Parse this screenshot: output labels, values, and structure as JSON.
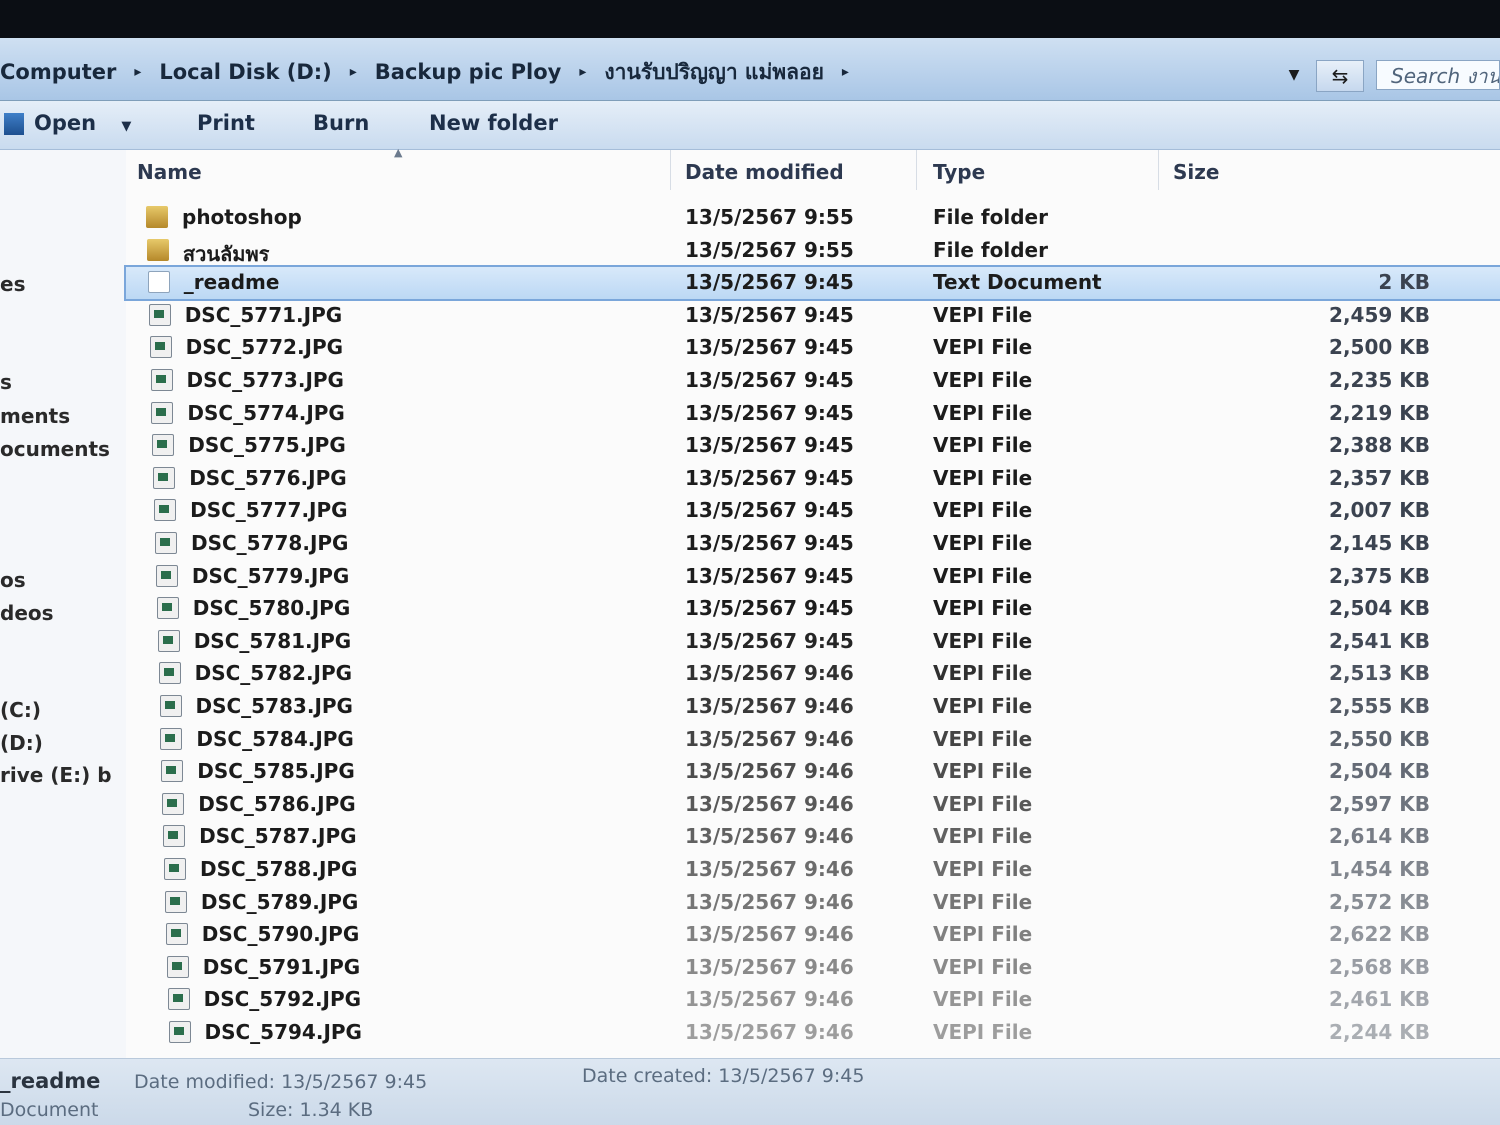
{
  "address": {
    "crumbs": [
      "Computer",
      "Local Disk (D:)",
      "Backup pic Ploy",
      "งานรับปริญญา แม่พลอย"
    ],
    "separator": "▸",
    "dropdown_icon": "chevron-down-icon",
    "refresh_icon": "refresh-icon",
    "search_placeholder": "Search งาน"
  },
  "toolbar": {
    "open_label": "Open",
    "print_label": "Print",
    "burn_label": "Burn",
    "new_folder_label": "New folder"
  },
  "nav": {
    "items": [
      "es",
      "s",
      "ments",
      "ocuments",
      "os",
      "deos",
      "(C:)",
      "(D:)",
      "rive (E:) b"
    ]
  },
  "columns": {
    "name": "Name",
    "date": "Date modified",
    "type": "Type",
    "size": "Size"
  },
  "files": [
    {
      "icon": "folder",
      "name": "photoshop",
      "date": "13/5/2567 9:55",
      "type": "File folder",
      "size": ""
    },
    {
      "icon": "folder",
      "name": "สวนลัมพร",
      "date": "13/5/2567 9:55",
      "type": "File folder",
      "size": ""
    },
    {
      "icon": "text",
      "name": "_readme",
      "date": "13/5/2567 9:45",
      "type": "Text Document",
      "size": "2 KB",
      "selected": true
    },
    {
      "icon": "image",
      "name": "DSC_5771.JPG",
      "date": "13/5/2567 9:45",
      "type": "VEPI File",
      "size": "2,459 KB"
    },
    {
      "icon": "image",
      "name": "DSC_5772.JPG",
      "date": "13/5/2567 9:45",
      "type": "VEPI File",
      "size": "2,500 KB"
    },
    {
      "icon": "image",
      "name": "DSC_5773.JPG",
      "date": "13/5/2567 9:45",
      "type": "VEPI File",
      "size": "2,235 KB"
    },
    {
      "icon": "image",
      "name": "DSC_5774.JPG",
      "date": "13/5/2567 9:45",
      "type": "VEPI File",
      "size": "2,219 KB"
    },
    {
      "icon": "image",
      "name": "DSC_5775.JPG",
      "date": "13/5/2567 9:45",
      "type": "VEPI File",
      "size": "2,388 KB"
    },
    {
      "icon": "image",
      "name": "DSC_5776.JPG",
      "date": "13/5/2567 9:45",
      "type": "VEPI File",
      "size": "2,357 KB"
    },
    {
      "icon": "image",
      "name": "DSC_5777.JPG",
      "date": "13/5/2567 9:45",
      "type": "VEPI File",
      "size": "2,007 KB"
    },
    {
      "icon": "image",
      "name": "DSC_5778.JPG",
      "date": "13/5/2567 9:45",
      "type": "VEPI File",
      "size": "2,145 KB"
    },
    {
      "icon": "image",
      "name": "DSC_5779.JPG",
      "date": "13/5/2567 9:45",
      "type": "VEPI File",
      "size": "2,375 KB"
    },
    {
      "icon": "image",
      "name": "DSC_5780.JPG",
      "date": "13/5/2567 9:45",
      "type": "VEPI File",
      "size": "2,504 KB"
    },
    {
      "icon": "image",
      "name": "DSC_5781.JPG",
      "date": "13/5/2567 9:45",
      "type": "VEPI File",
      "size": "2,541 KB"
    },
    {
      "icon": "image",
      "name": "DSC_5782.JPG",
      "date": "13/5/2567 9:46",
      "type": "VEPI File",
      "size": "2,513 KB"
    },
    {
      "icon": "image",
      "name": "DSC_5783.JPG",
      "date": "13/5/2567 9:46",
      "type": "VEPI File",
      "size": "2,555 KB"
    },
    {
      "icon": "image",
      "name": "DSC_5784.JPG",
      "date": "13/5/2567 9:46",
      "type": "VEPI File",
      "size": "2,550 KB"
    },
    {
      "icon": "image",
      "name": "DSC_5785.JPG",
      "date": "13/5/2567 9:46",
      "type": "VEPI File",
      "size": "2,504 KB"
    },
    {
      "icon": "image",
      "name": "DSC_5786.JPG",
      "date": "13/5/2567 9:46",
      "type": "VEPI File",
      "size": "2,597 KB"
    },
    {
      "icon": "image",
      "name": "DSC_5787.JPG",
      "date": "13/5/2567 9:46",
      "type": "VEPI File",
      "size": "2,614 KB"
    },
    {
      "icon": "image",
      "name": "DSC_5788.JPG",
      "date": "13/5/2567 9:46",
      "type": "VEPI File",
      "size": "1,454 KB"
    },
    {
      "icon": "image",
      "name": "DSC_5789.JPG",
      "date": "13/5/2567 9:46",
      "type": "VEPI File",
      "size": "2,572 KB"
    },
    {
      "icon": "image",
      "name": "DSC_5790.JPG",
      "date": "13/5/2567 9:46",
      "type": "VEPI File",
      "size": "2,622 KB"
    },
    {
      "icon": "image",
      "name": "DSC_5791.JPG",
      "date": "13/5/2567 9:46",
      "type": "VEPI File",
      "size": "2,568 KB"
    },
    {
      "icon": "image",
      "name": "DSC_5792.JPG",
      "date": "13/5/2567 9:46",
      "type": "VEPI File",
      "size": "2,461 KB"
    },
    {
      "icon": "image",
      "name": "DSC_5794.JPG",
      "date": "13/5/2567 9:46",
      "type": "VEPI File",
      "size": "2,244 KB"
    }
  ],
  "details": {
    "name": "_readme",
    "kind": "Document",
    "modified_label": "Date modified:",
    "modified": "13/5/2567 9:45",
    "size_label": "Size:",
    "size": "1.34 KB",
    "created_label": "Date created:",
    "created": "13/5/2567 9:45"
  }
}
